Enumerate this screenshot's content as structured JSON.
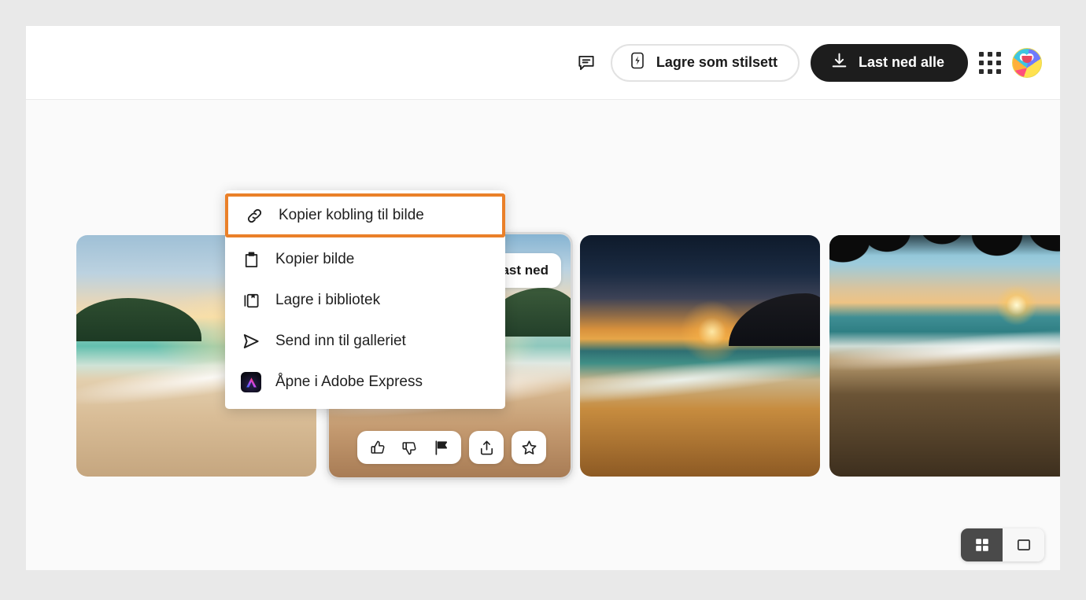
{
  "header": {
    "feedback_icon": "comment-icon",
    "save_style_button": {
      "label": "Lagre som stilsett",
      "icon": "lightning-bolt-icon"
    },
    "download_all_button": {
      "label": "Last ned alle",
      "icon": "download-icon"
    },
    "apps_icon": "app-grid-icon",
    "avatar_icon": "user-avatar"
  },
  "context_menu": {
    "items": [
      {
        "label": "Kopier kobling til bilde",
        "icon": "link-icon",
        "focused": true
      },
      {
        "label": "Kopier bilde",
        "icon": "clipboard-icon",
        "focused": false
      },
      {
        "label": "Lagre i bibliotek",
        "icon": "library-save-icon",
        "focused": false
      },
      {
        "label": "Send inn til galleriet",
        "icon": "send-icon",
        "focused": false
      },
      {
        "label": "Åpne i Adobe Express",
        "icon": "adobe-express-icon",
        "focused": false
      }
    ],
    "focus_border_color": "#ea8029"
  },
  "gallery": {
    "cards": [
      {
        "name": "tropical-beach-turquoise-sunset",
        "hovered": false
      },
      {
        "name": "beach-wave-golden-sand",
        "hovered": true
      },
      {
        "name": "dramatic-sunset-over-ocean",
        "hovered": false
      },
      {
        "name": "sunset-through-palm-silhouette",
        "hovered": false
      }
    ],
    "hover_card": {
      "download_label": "Last ned",
      "download_icon": "download-icon",
      "actions": [
        {
          "icon": "thumbs-up-icon",
          "name": "like-button"
        },
        {
          "icon": "thumbs-down-icon",
          "name": "dislike-button"
        },
        {
          "icon": "flag-icon",
          "name": "report-button"
        },
        {
          "icon": "share-icon",
          "name": "share-button"
        },
        {
          "icon": "star-icon",
          "name": "favorite-button"
        }
      ]
    }
  },
  "view_toggle": {
    "options": [
      {
        "icon": "grid-view-icon",
        "name": "grid-view-button",
        "active": true
      },
      {
        "icon": "single-view-icon",
        "name": "single-view-button",
        "active": false
      }
    ]
  },
  "colors": {
    "page_background": "#e9e9e9",
    "surface": "#ffffff",
    "canvas": "#fafafa",
    "primary_button": "#1d1d1d",
    "accent_focus": "#ea8029"
  }
}
